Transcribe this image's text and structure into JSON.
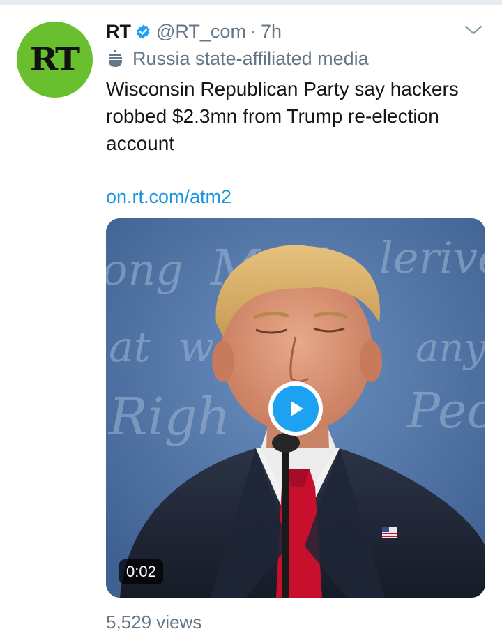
{
  "tweet": {
    "avatar_text": "RT",
    "author_name": "RT",
    "handle": "@RT_com",
    "separator": "·",
    "time": "7h",
    "affiliation": "Russia state-affiliated media",
    "text": "Wisconsin Republican Party say hackers robbed $2.3mn from Trump re-election account",
    "link": "on.rt.com/atm2",
    "video": {
      "duration": "0:02",
      "backdrop_text": [
        "ong",
        "Masl",
        "lerive",
        "at",
        "w",
        "any",
        "Righ",
        "Peo"
      ]
    },
    "views": "5,529 views"
  },
  "colors": {
    "brand_blue": "#1da1f2",
    "link_blue": "#1b95e0",
    "muted_gray": "#657786",
    "rt_green": "#6abf2f"
  },
  "icons": [
    "verified-badge-icon",
    "state-media-podium-icon",
    "chevron-down-icon",
    "play-icon"
  ]
}
